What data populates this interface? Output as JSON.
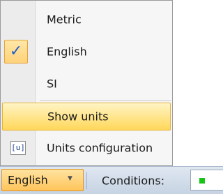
{
  "menu": {
    "items": [
      {
        "label": "Metric",
        "checked": false
      },
      {
        "label": "English",
        "checked": true
      },
      {
        "label": "SI",
        "checked": false
      },
      {
        "label": "Show units",
        "highlighted": true
      },
      {
        "label": "Units configuration",
        "icon": "units-config-icon",
        "icon_text": "[u]"
      }
    ],
    "check_glyph": "✓"
  },
  "statusbar": {
    "units_dropdown_label": "English",
    "dropdown_arrow": "▼",
    "conditions_label": "Conditions:",
    "conditions_status_color": "#19c419"
  },
  "colors": {
    "highlight": "#ffd75a",
    "check": "#1f5fc9"
  }
}
